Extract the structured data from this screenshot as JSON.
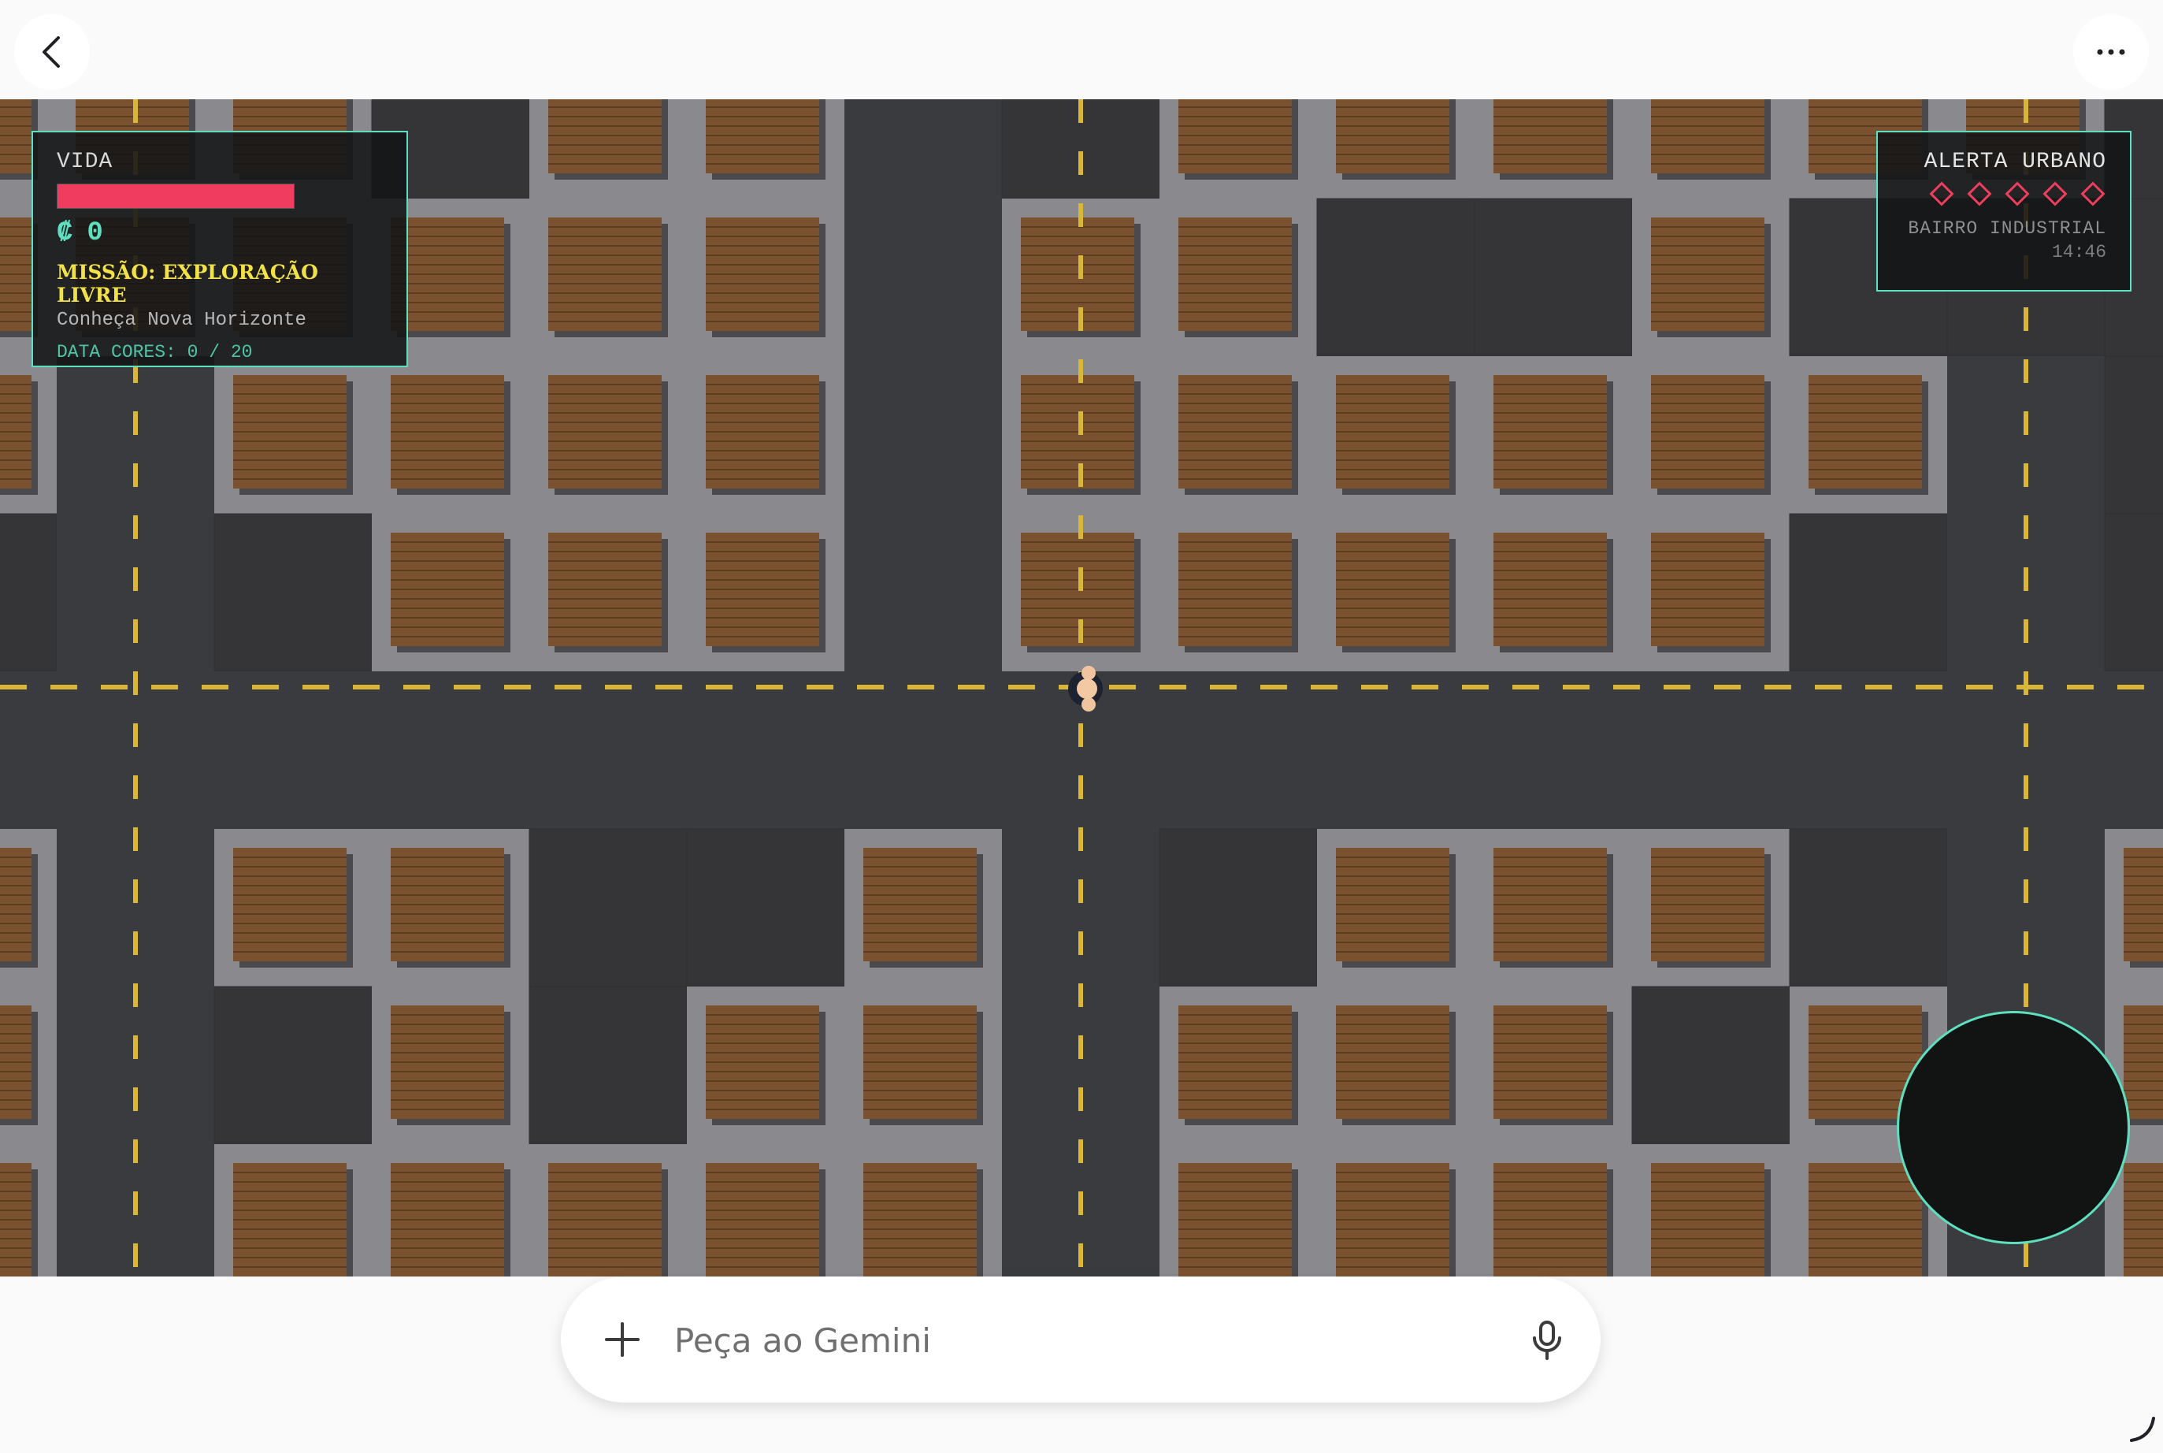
{
  "topbar": {
    "back_icon": "chevron-left-icon",
    "more_icon": "more-horizontal-icon"
  },
  "game": {
    "hud_left": {
      "health_label": "VIDA",
      "health_fraction": 1.0,
      "currency_symbol": "₡",
      "currency_value": "0",
      "mission_title": "MISSÃO: EXPLORAÇÃO LIVRE",
      "mission_subtitle": "Conheça Nova Horizonte",
      "data_cores": "DATA CORES: 0 / 20"
    },
    "hud_right": {
      "title": "ALERTA URBANO",
      "wanted_stars_filled": 0,
      "wanted_stars_total": 5,
      "district": "BAIRRO INDUSTRIAL",
      "clock": "14:46"
    },
    "map": {
      "grid": [
        "BBBXBBRXBBBBBBX",
        "BBBBBBRBBXXBXXX",
        "BRBBBBRBBBBBBRX",
        "XRXBBBRBBBBBXRX",
        "RRRRRRRRRRRRRRR",
        "BRBBXXBRXBBBXRB",
        "BRXBXBBRBBBXBRB",
        "BRBBBBBRBBBBBRB",
        "BRBBBBBRBBBBBRB"
      ]
    },
    "colors": {
      "road": "#3a3b3f",
      "lot": "#353538",
      "curb": "#8a8a8e",
      "crate": "#7b5230",
      "lane": "#d8b637",
      "accent": "#5ee0c0",
      "alert": "#ef3c5f"
    }
  },
  "prompt": {
    "placeholder": "Peça ao Gemini",
    "plus_icon": "plus-icon",
    "mic_icon": "mic-icon"
  }
}
